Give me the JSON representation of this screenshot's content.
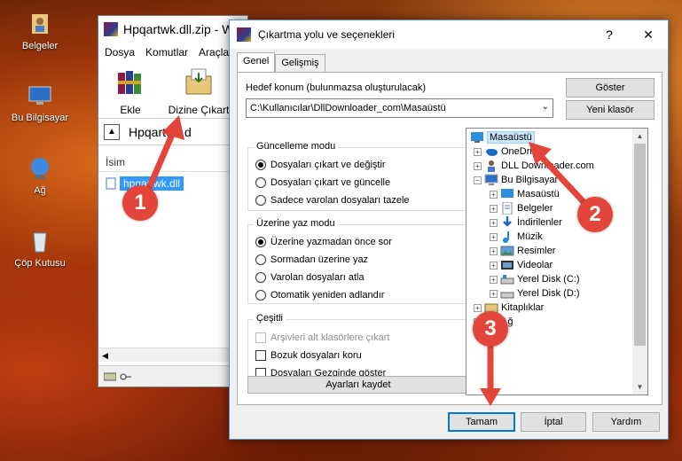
{
  "desktop": {
    "icons": [
      {
        "label": "Belgeler",
        "icon": "folder-user-icon"
      },
      {
        "label": "Bu Bilgisayar",
        "icon": "computer-icon"
      },
      {
        "label": "Ağ",
        "icon": "network-icon"
      },
      {
        "label": "Çöp Kutusu",
        "icon": "recycle-bin-icon"
      }
    ]
  },
  "winrar": {
    "title": "Hpqartwk.dll.zip - W",
    "menu": [
      "Dosya",
      "Komutlar",
      "Araçla"
    ],
    "toolbar": {
      "add": "Ekle",
      "extract_to": "Dizine Çıkart"
    },
    "address": "Hpqartwk.d",
    "column_name": "İsim",
    "file": "hpqartwk.dll"
  },
  "dialog": {
    "title": "Çıkartma yolu ve seçenekleri",
    "help_glyph": "?",
    "close_glyph": "✕",
    "tabs": [
      "Genel",
      "Gelişmiş"
    ],
    "dest_label": "Hedef konum (bulunmazsa oluşturulacak)",
    "dest_value": "C:\\Kullanıcılar\\DllDownloader_com\\Masaüstü",
    "show_btn": "Göster",
    "new_folder_btn": "Yeni klasör",
    "update_mode": {
      "title": "Güncelleme modu",
      "options": [
        "Dosyaları çıkart ve değiştir",
        "Dosyaları çıkart ve güncelle",
        "Sadece varolan dosyaları tazele"
      ],
      "selected": 0
    },
    "overwrite_mode": {
      "title": "Üzerine yaz modu",
      "options": [
        "Üzerine yazmadan önce sor",
        "Sormadan üzerine yaz",
        "Varolan dosyaları atla",
        "Otomatik yeniden adlandır"
      ],
      "selected": 0
    },
    "misc": {
      "title": "Çeşitli",
      "options": [
        "Arşivleri alt klasörlere çıkart",
        "Bozuk dosyaları koru",
        "Dosyaları Gezginde göster"
      ]
    },
    "save_settings_btn": "Ayarları kaydet",
    "tree": [
      {
        "label": "Masaüstü",
        "icon": "desktop-icon",
        "selected": true
      },
      {
        "label": "OneDrive",
        "icon": "onedrive-icon"
      },
      {
        "label": "DLL Downloader.com",
        "icon": "user-icon"
      },
      {
        "label": "Bu Bilgisayar",
        "icon": "computer-icon"
      },
      {
        "label": "Masaüstü",
        "icon": "desktop-icon"
      },
      {
        "label": "Belgeler",
        "icon": "documents-icon"
      },
      {
        "label": "İndirilenler",
        "icon": "downloads-icon"
      },
      {
        "label": "Müzik",
        "icon": "music-icon"
      },
      {
        "label": "Resimler",
        "icon": "pictures-icon"
      },
      {
        "label": "Videolar",
        "icon": "videos-icon"
      },
      {
        "label": "Yerel Disk (C:)",
        "icon": "drive-icon"
      },
      {
        "label": "Yerel Disk (D:)",
        "icon": "drive-icon"
      },
      {
        "label": "Kitaplıklar",
        "icon": "libraries-icon"
      },
      {
        "label": "Ağ",
        "icon": "network-icon"
      }
    ],
    "ok_btn": "Tamam",
    "cancel_btn": "İptal",
    "help_btn": "Yardım"
  },
  "annotations": [
    "1",
    "2",
    "3"
  ],
  "colors": {
    "badge": "#e3453a",
    "accent": "#0078d7",
    "selection": "#3399ff"
  }
}
